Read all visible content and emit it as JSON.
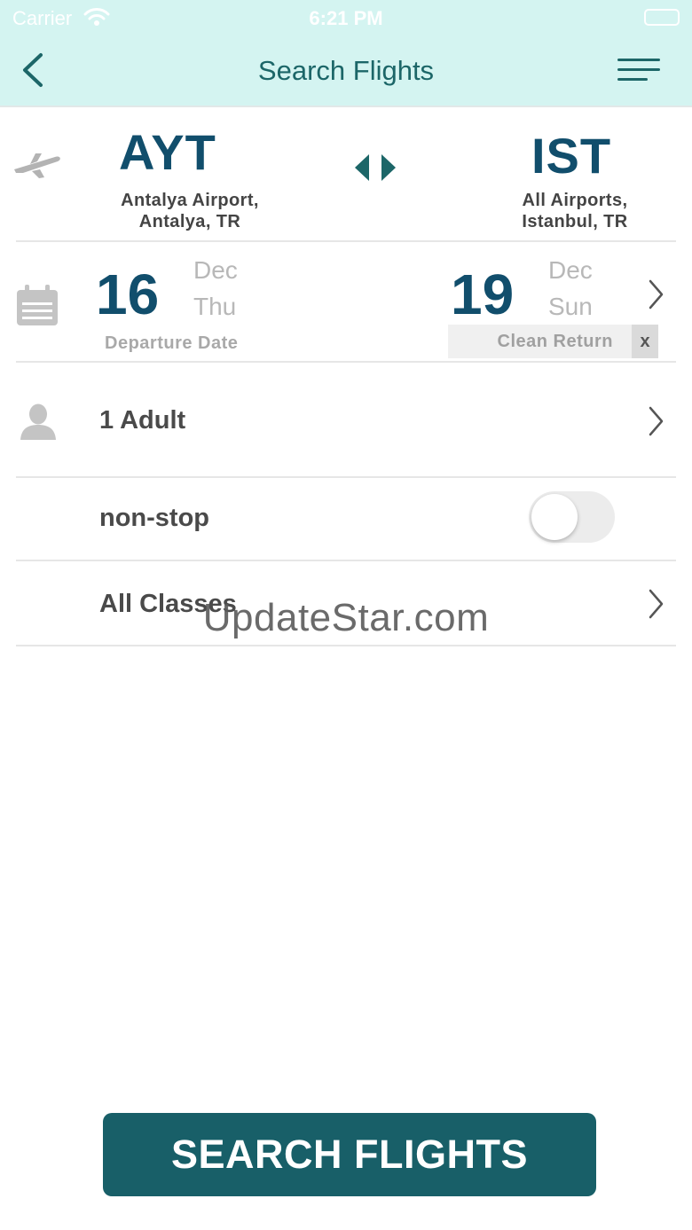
{
  "status_bar": {
    "carrier": "Carrier",
    "time": "6:21 PM"
  },
  "header": {
    "title": "Search Flights"
  },
  "route": {
    "origin": {
      "code": "AYT",
      "airport": "Antalya Airport,",
      "city": "Antalya, TR"
    },
    "destination": {
      "code": "IST",
      "airport": "All Airports,",
      "city": "Istanbul, TR"
    }
  },
  "dates": {
    "departure": {
      "day": "16",
      "month": "Dec",
      "weekday": "Thu",
      "label": "Departure Date"
    },
    "return": {
      "day": "19",
      "month": "Dec",
      "weekday": "Sun",
      "clear_label": "Clean Return",
      "clear_x": "x"
    }
  },
  "passengers": {
    "label": "1 Adult"
  },
  "nonstop": {
    "label": "non-stop",
    "enabled": false
  },
  "cabin": {
    "label": "All Classes"
  },
  "watermark": "UpdateStar.com",
  "search_button": {
    "label": "SEARCH FLIGHTS"
  },
  "colors": {
    "header_bg": "#d4f4f1",
    "accent": "#1c6668",
    "code_blue": "#114e6c",
    "button_bg": "#185f68"
  },
  "icons": [
    "wifi-icon",
    "battery-icon",
    "back-chevron-icon",
    "hamburger-menu-icon",
    "plane-icon",
    "swap-arrows-icon",
    "calendar-icon",
    "chevron-right-icon",
    "person-icon"
  ]
}
